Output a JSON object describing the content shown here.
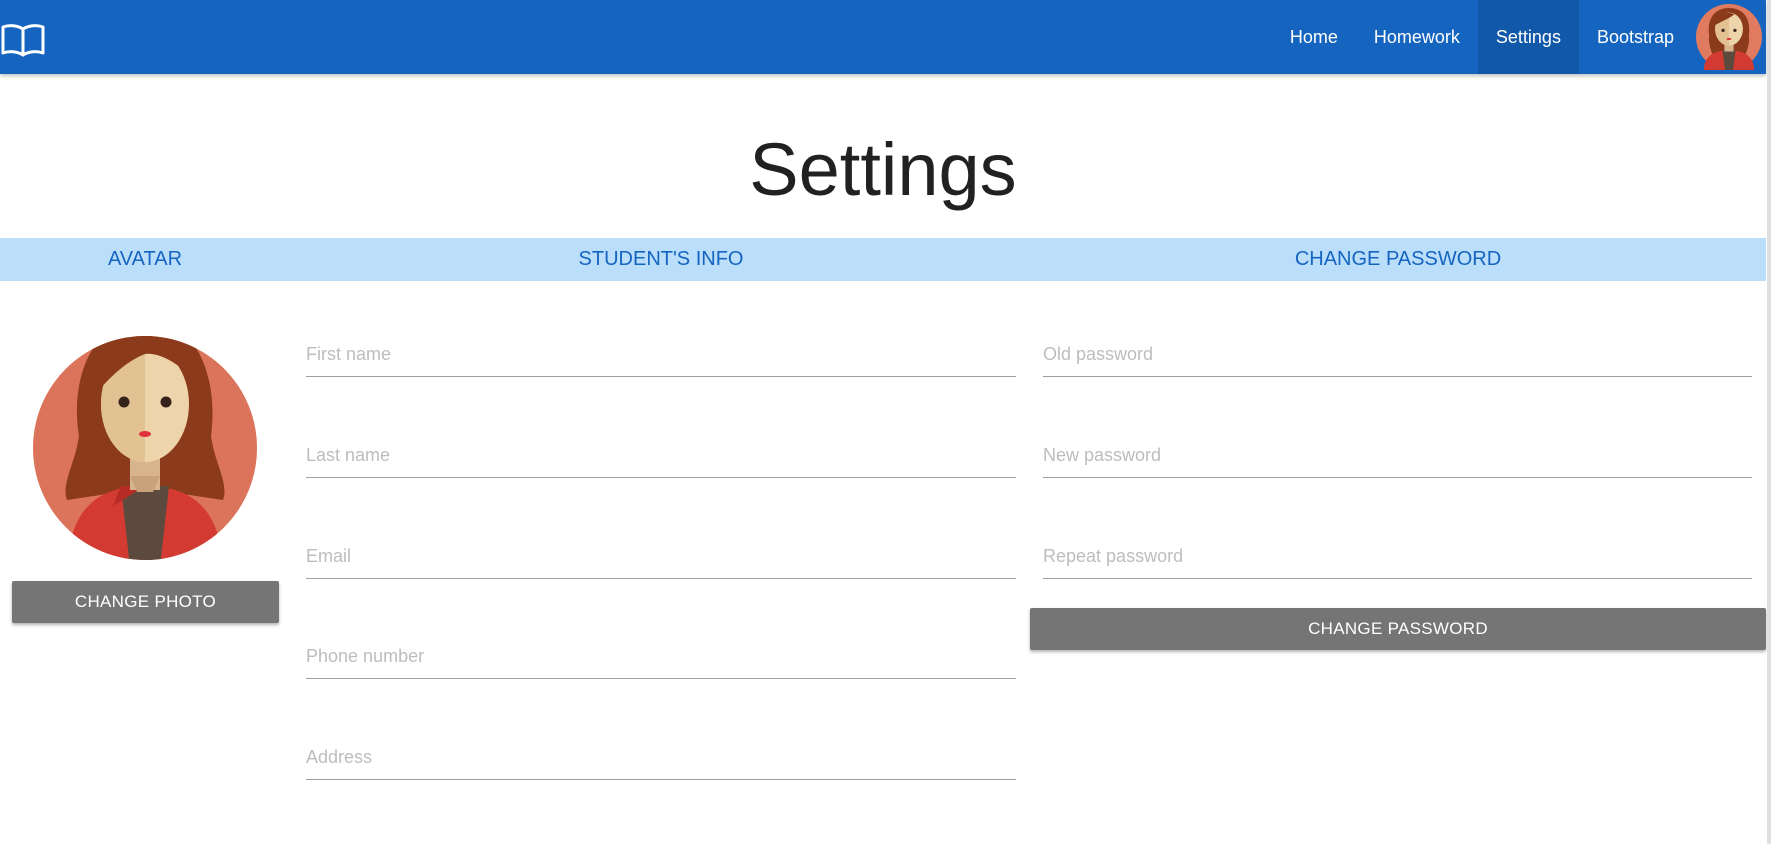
{
  "navbar": {
    "brand_icon": "open-book-icon",
    "links": [
      {
        "label": "Home",
        "active": false
      },
      {
        "label": "Homework",
        "active": false
      },
      {
        "label": "Settings",
        "active": true
      },
      {
        "label": "Bootstrap",
        "active": false
      }
    ],
    "avatar_icon": "user-avatar"
  },
  "page": {
    "title": "Settings"
  },
  "sections": {
    "avatar": "AVATAR",
    "student_info": "STUDENT'S INFO",
    "change_password": "CHANGE PASSWORD"
  },
  "avatar": {
    "image": "woman-avatar-illustration",
    "change_photo_label": "CHANGE PHOTO"
  },
  "student_info": {
    "fields": [
      {
        "name": "first-name",
        "placeholder": "First name",
        "value": ""
      },
      {
        "name": "last-name",
        "placeholder": "Last name",
        "value": ""
      },
      {
        "name": "email",
        "placeholder": "Email",
        "value": ""
      },
      {
        "name": "phone-number",
        "placeholder": "Phone number",
        "value": ""
      },
      {
        "name": "address",
        "placeholder": "Address",
        "value": ""
      }
    ]
  },
  "password": {
    "fields": [
      {
        "name": "old-password",
        "placeholder": "Old password",
        "value": ""
      },
      {
        "name": "new-password",
        "placeholder": "New password",
        "value": ""
      },
      {
        "name": "repeat-password",
        "placeholder": "Repeat password",
        "value": ""
      }
    ],
    "submit_label": "CHANGE PASSWORD"
  },
  "colors": {
    "navbar": "#1565c0",
    "section_bar": "#bbdefb",
    "section_text": "#1565c0",
    "button": "#757575"
  }
}
